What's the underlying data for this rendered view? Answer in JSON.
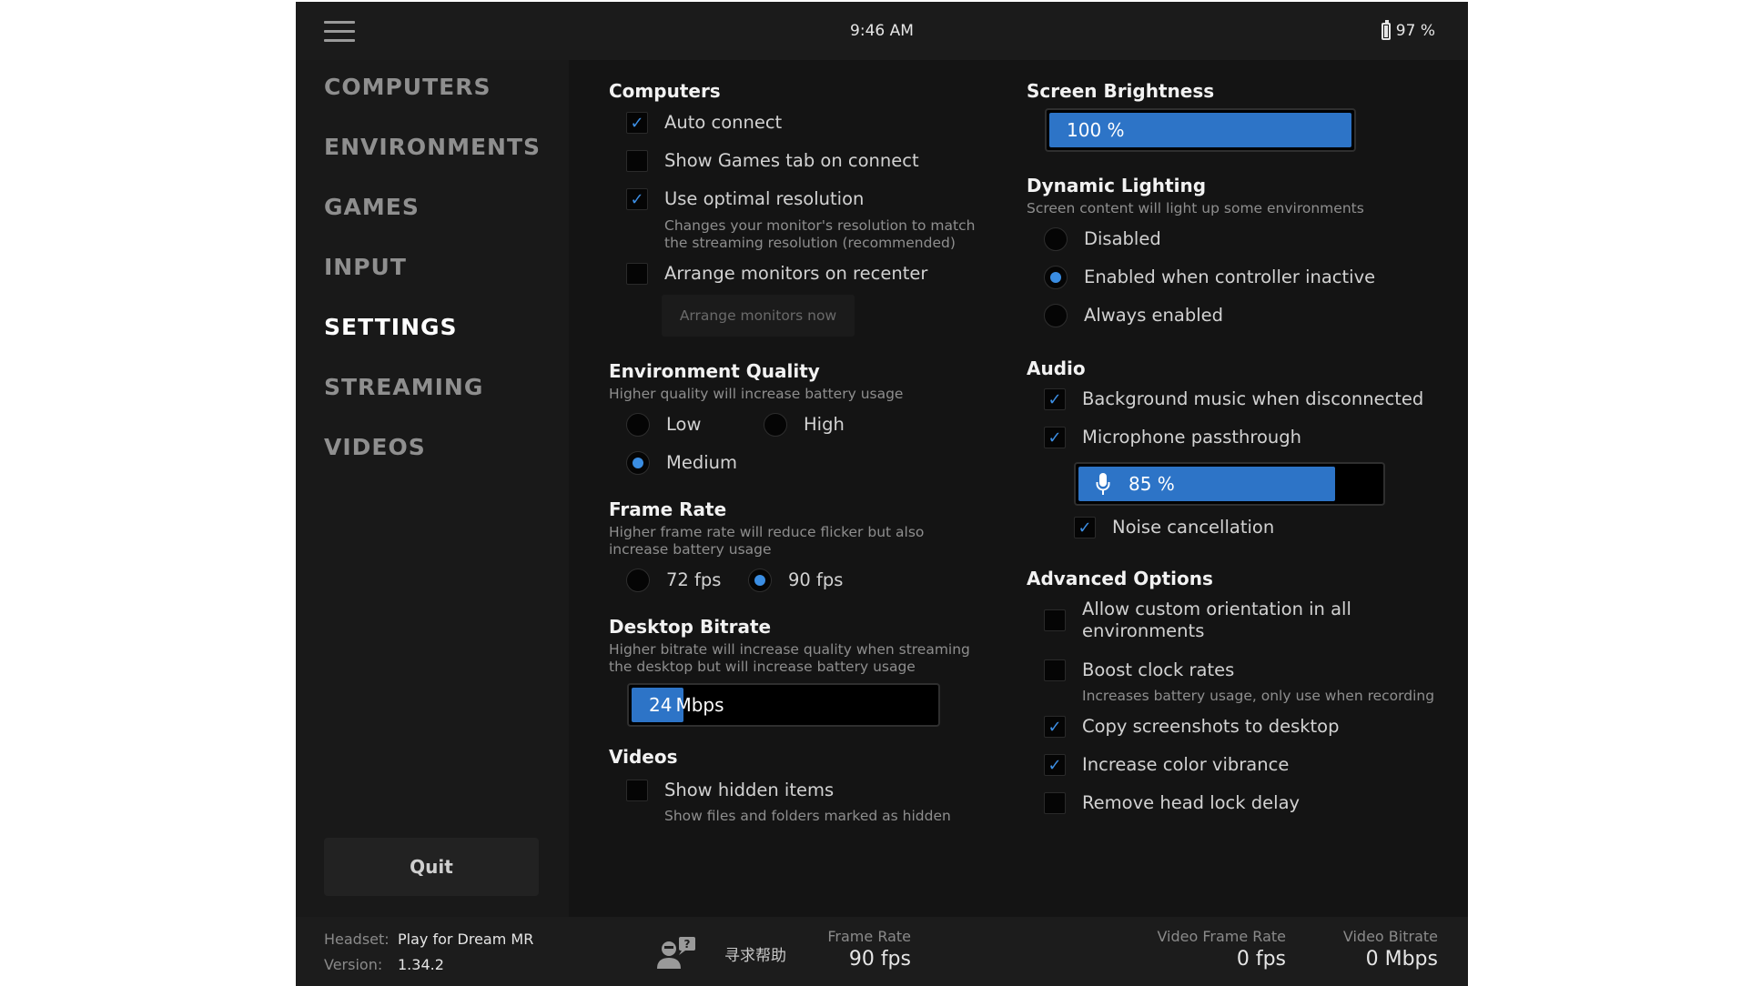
{
  "topbar": {
    "time": "9:46 AM",
    "battery": "97 %"
  },
  "sidebar": {
    "items": [
      {
        "label": "COMPUTERS"
      },
      {
        "label": "ENVIRONMENTS"
      },
      {
        "label": "GAMES"
      },
      {
        "label": "INPUT"
      },
      {
        "label": "SETTINGS",
        "active": true
      },
      {
        "label": "STREAMING"
      },
      {
        "label": "VIDEOS"
      }
    ],
    "quit": "Quit"
  },
  "computers": {
    "title": "Computers",
    "auto_connect": {
      "label": "Auto connect",
      "checked": true
    },
    "show_games_tab": {
      "label": "Show Games tab on connect",
      "checked": false
    },
    "optimal_resolution": {
      "label": "Use optimal resolution",
      "checked": true,
      "desc1": "Changes your monitor's resolution to match",
      "desc2": "the streaming resolution (recommended)"
    },
    "arrange_monitors": {
      "label": "Arrange monitors on recenter",
      "checked": false
    },
    "arrange_now": "Arrange monitors now"
  },
  "environment_quality": {
    "title": "Environment Quality",
    "desc": "Higher quality will increase battery usage",
    "options": {
      "low": "Low",
      "high": "High",
      "medium": "Medium"
    },
    "selected": "Medium"
  },
  "frame_rate": {
    "title": "Frame Rate",
    "desc1": "Higher frame rate will reduce flicker but also",
    "desc2": "increase battery usage",
    "options": {
      "fps72": "72 fps",
      "fps90": "90 fps"
    },
    "selected": "90 fps"
  },
  "desktop_bitrate": {
    "title": "Desktop Bitrate",
    "desc1": "Higher bitrate will increase quality when streaming",
    "desc2": "the desktop but will increase battery usage",
    "value": "24",
    "unit": "Mbps",
    "fill_fraction": 0.17
  },
  "videos": {
    "title": "Videos",
    "show_hidden": {
      "label": "Show hidden items",
      "checked": false,
      "desc": "Show files and folders marked as hidden"
    }
  },
  "screen_brightness": {
    "title": "Screen Brightness",
    "value": "100 %",
    "fill_fraction": 1.0
  },
  "dynamic_lighting": {
    "title": "Dynamic Lighting",
    "desc": "Screen content will light up some environments",
    "options": {
      "disabled": "Disabled",
      "enabled_inactive": "Enabled when controller inactive",
      "always": "Always enabled"
    },
    "selected": "Enabled when controller inactive"
  },
  "audio": {
    "title": "Audio",
    "bg_music": {
      "label": "Background music when disconnected",
      "checked": true
    },
    "mic_passthrough": {
      "label": "Microphone passthrough",
      "checked": true
    },
    "mic_level": "85 %",
    "mic_fill_fraction": 0.85,
    "noise_cancellation": {
      "label": "Noise cancellation",
      "checked": true
    }
  },
  "advanced": {
    "title": "Advanced Options",
    "custom_orientation": {
      "label1": "Allow custom orientation in all",
      "label2": "environments",
      "checked": false
    },
    "boost_clock": {
      "label": "Boost clock rates",
      "checked": false,
      "desc": "Increases battery usage, only use when recording"
    },
    "copy_screenshots": {
      "label": "Copy screenshots to desktop",
      "checked": true
    },
    "color_vibrance": {
      "label": "Increase color vibrance",
      "checked": true
    },
    "head_lock_delay": {
      "label": "Remove head lock delay",
      "checked": false
    }
  },
  "footer": {
    "headset_label": "Headset:",
    "headset_value": "Play for Dream MR",
    "version_label": "Version:",
    "version_value": "1.34.2",
    "help_text": "寻求帮助",
    "frame_rate_label": "Frame Rate",
    "frame_rate_value": "90 fps",
    "video_frame_rate_label": "Video Frame Rate",
    "video_frame_rate_value": "0 fps",
    "video_bitrate_label": "Video Bitrate",
    "video_bitrate_value": "0 Mbps"
  },
  "colors": {
    "accent": "#2d74c7",
    "radio_dot": "#3a8de2",
    "background": "#141414",
    "sidebar": "#191919"
  }
}
